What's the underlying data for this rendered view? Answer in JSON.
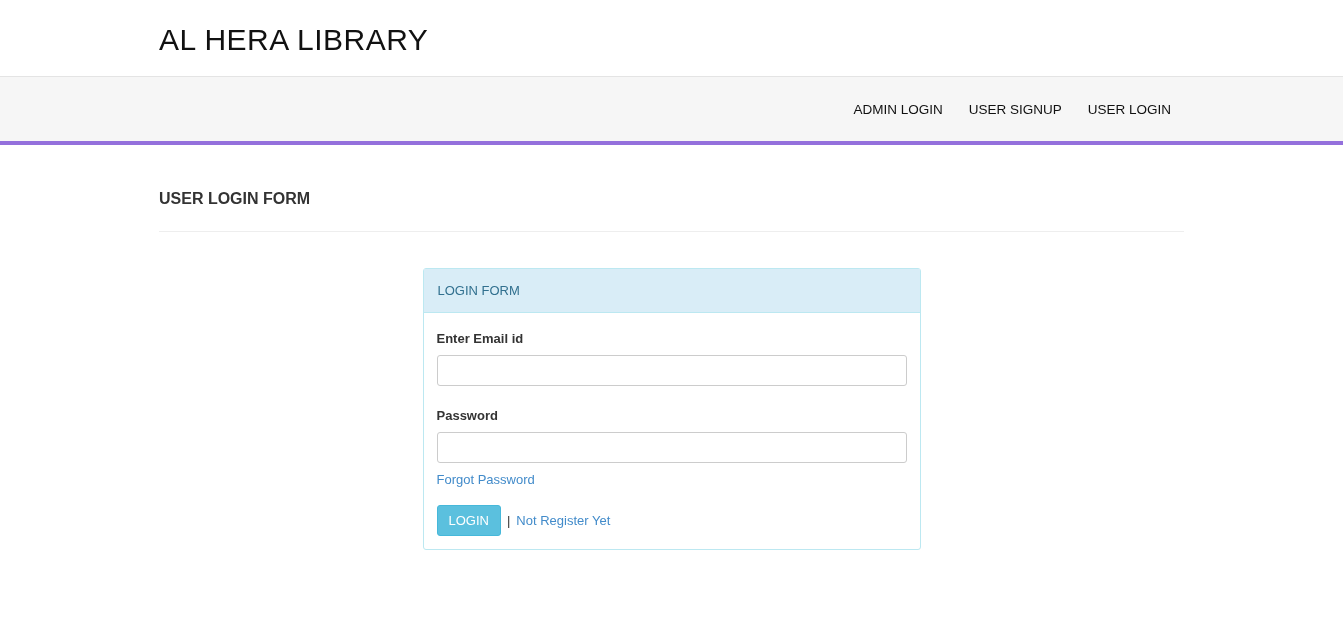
{
  "brand": "AL HERA LIBRARY",
  "nav": [
    {
      "label": "ADMIN LOGIN"
    },
    {
      "label": "USER SIGNUP"
    },
    {
      "label": "USER LOGIN"
    }
  ],
  "page_heading": "USER LOGIN FORM",
  "panel": {
    "title": "LOGIN FORM",
    "fields": [
      {
        "label": "Enter Email id"
      },
      {
        "label": "Password"
      }
    ],
    "forgot_link": "Forgot Password",
    "submit_button": "LOGIN",
    "separator": "|",
    "register_link": "Not Register Yet"
  }
}
